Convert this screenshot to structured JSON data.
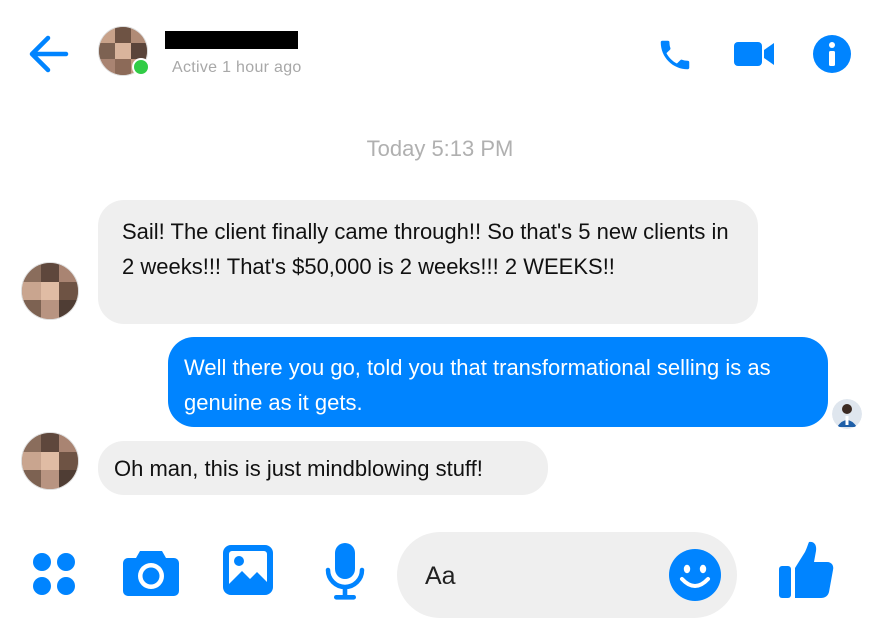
{
  "header": {
    "status_text": "Active 1 hour ago"
  },
  "conversation": {
    "timestamp": "Today 5:13 PM",
    "messages": [
      {
        "direction": "incoming",
        "text": "Sail! The client finally came through!! So that's 5 new clients in 2 weeks!!! That's $50,000 is 2 weeks!!! 2 WEEKS!!"
      },
      {
        "direction": "outgoing",
        "text": "Well there you go, told you that transformational selling is as genuine as it gets."
      },
      {
        "direction": "incoming",
        "text": "Oh man, this is just mindblowing stuff!"
      }
    ]
  },
  "composer": {
    "placeholder": "Aa"
  },
  "colors": {
    "accent": "#0084ff",
    "incoming_bubble": "#efefef",
    "online": "#31cc46",
    "muted_text": "#a8a8a8"
  },
  "icons": [
    "back-arrow-icon",
    "phone-icon",
    "video-camera-icon",
    "info-icon",
    "more-dots-icon",
    "camera-icon",
    "image-icon",
    "microphone-icon",
    "emoji-icon",
    "thumbs-up-icon"
  ]
}
